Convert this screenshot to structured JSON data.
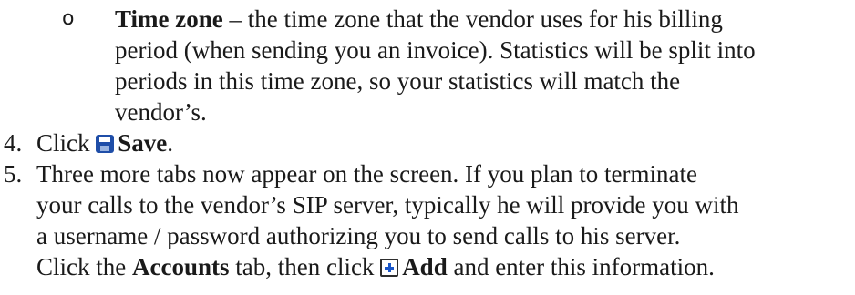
{
  "sub_bullet": {
    "marker": "o",
    "term": "Time zone",
    "lines": [
      " – the time zone that the vendor uses for his billing",
      "period (when sending you an invoice). Statistics will be split into",
      "periods in this time zone, so your statistics will match the",
      "vendor’s."
    ]
  },
  "step4": {
    "number": "4.",
    "prefix": "Click ",
    "icon": "save-icon",
    "action": "Save",
    "suffix": "."
  },
  "step5": {
    "number": "5.",
    "lines": [
      "Three more tabs now appear on the screen. If you plan to terminate",
      "your calls to the vendor’s SIP server, typically he will provide you with",
      "a username / password authorizing you to send calls to his server."
    ],
    "last_line": {
      "prefix": "Click the ",
      "tab": "Accounts",
      "middle": " tab, then click ",
      "icon": "add-icon",
      "action": "Add",
      "suffix": " and enter this information."
    }
  }
}
